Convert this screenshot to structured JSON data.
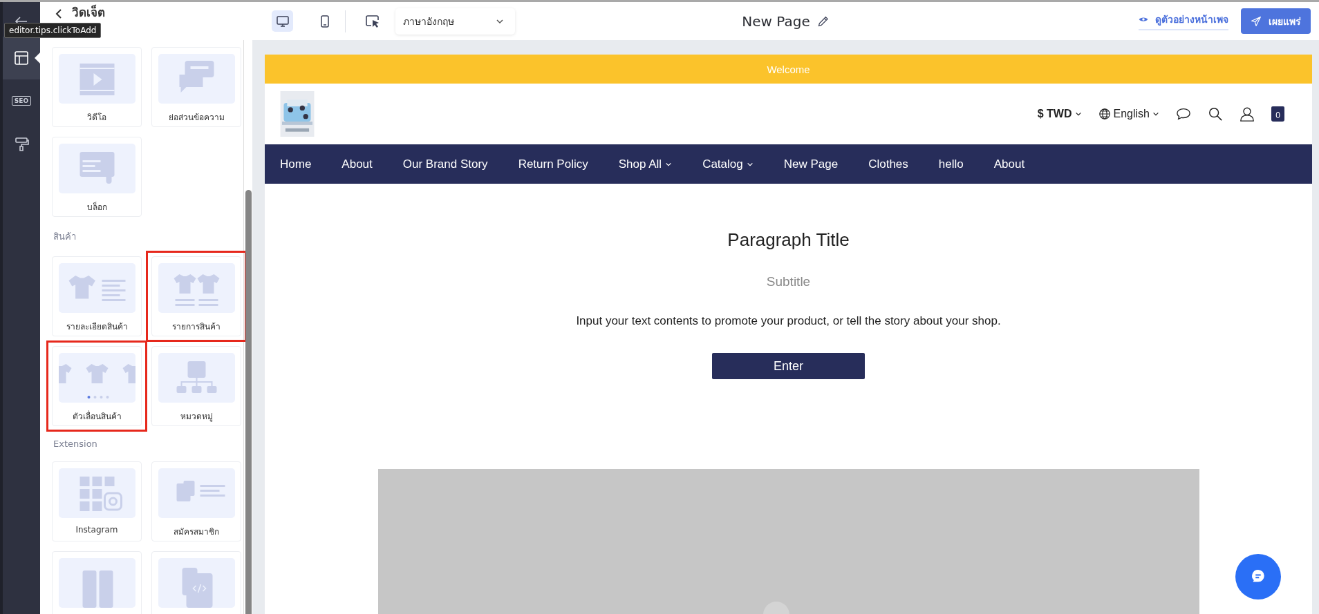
{
  "rail": {
    "items": [
      {
        "kind": "back",
        "selected": false
      },
      {
        "kind": "layout",
        "selected": true
      },
      {
        "kind": "seo",
        "label": "SEO",
        "selected": false
      },
      {
        "kind": "paint",
        "selected": false
      }
    ]
  },
  "tooltip": "editor.tips.clickToAdd",
  "panel": {
    "title": "วิดเจ็ต",
    "sections": [
      {
        "widgets": [
          {
            "kind": "video",
            "label": "วิดีโอ",
            "highlighted": false
          },
          {
            "kind": "faq",
            "label": "ย่อส่วนข้อความ",
            "highlighted": false
          },
          {
            "kind": "blog",
            "label": "บล็อก",
            "highlighted": false
          }
        ]
      },
      {
        "heading": "สินค้า",
        "widgets": [
          {
            "kind": "product-detail",
            "label": "รายละเอียดสินค้า",
            "highlighted": false
          },
          {
            "kind": "product-list",
            "label": "รายการสินค้า",
            "highlighted": true
          },
          {
            "kind": "product-slider",
            "label": "ตัวเลื่อนสินค้า",
            "highlighted": true
          },
          {
            "kind": "category",
            "label": "หมวดหมู่",
            "highlighted": false
          }
        ]
      },
      {
        "heading": "Extension",
        "widgets": [
          {
            "kind": "instagram",
            "label": "Instagram",
            "highlighted": false
          },
          {
            "kind": "signup",
            "label": "สมัครสมาชิก",
            "highlighted": false
          },
          {
            "kind": "counter",
            "highlighted": false
          },
          {
            "kind": "code",
            "highlighted": false
          }
        ]
      }
    ]
  },
  "toolbar": {
    "devices": [
      {
        "kind": "desktop",
        "selected": true
      },
      {
        "kind": "mobile",
        "selected": false
      }
    ],
    "language": "ภาษาอังกฤษ",
    "page_title": "New Page",
    "preview": "ดูตัวอย่างหน้าเพจ",
    "publish": "เผยแพร่"
  },
  "site": {
    "announcement": "Welcome",
    "currency": "$ TWD",
    "language": "English",
    "cart_count": "0",
    "nav": [
      {
        "label": "Home",
        "dropdown": false
      },
      {
        "label": "About",
        "dropdown": false
      },
      {
        "label": "Our Brand Story",
        "dropdown": false
      },
      {
        "label": "Return Policy",
        "dropdown": false
      },
      {
        "label": "Shop All",
        "dropdown": true
      },
      {
        "label": "Catalog",
        "dropdown": true
      },
      {
        "label": "New Page",
        "dropdown": false
      },
      {
        "label": "Clothes",
        "dropdown": false
      },
      {
        "label": "hello",
        "dropdown": false
      },
      {
        "label": "About",
        "dropdown": false
      }
    ],
    "section": {
      "title": "Paragraph Title",
      "subtitle": "Subtitle",
      "body": "Input your text contents to promote your product, or tell the story about your shop.",
      "button": "Enter"
    }
  }
}
